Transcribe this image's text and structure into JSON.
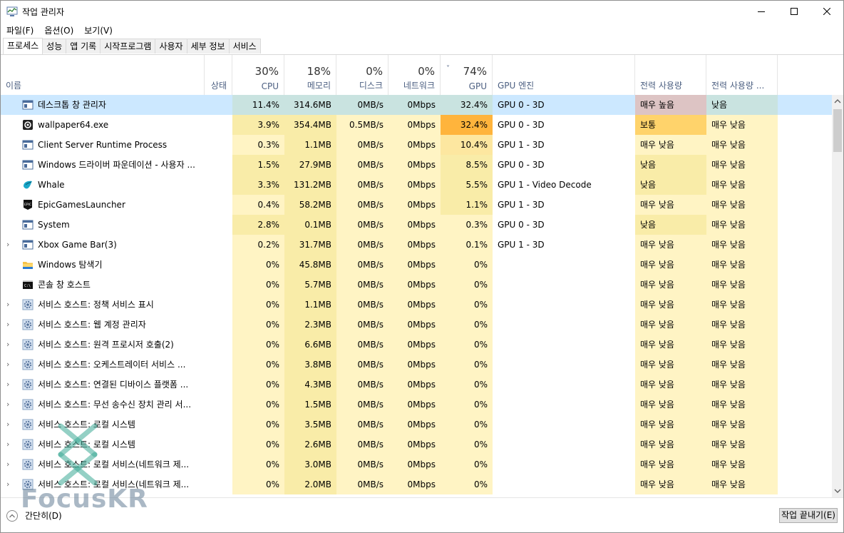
{
  "window": {
    "title": "작업 관리자",
    "app_icon": "task-manager-icon",
    "controls": {
      "minimize": "─",
      "maximize": "☐",
      "close": "✕"
    }
  },
  "menu": [
    "파일(F)",
    "옵션(O)",
    "보기(V)"
  ],
  "tabs": [
    "프로세스",
    "성능",
    "앱 기록",
    "시작프로그램",
    "사용자",
    "세부 정보",
    "서비스"
  ],
  "active_tab": "프로세스",
  "columns": {
    "name": "이름",
    "status": "상태",
    "cpu": {
      "pct": "30%",
      "label": "CPU"
    },
    "mem": {
      "pct": "18%",
      "label": "메모리"
    },
    "disk": {
      "pct": "0%",
      "label": "디스크"
    },
    "net": {
      "pct": "0%",
      "label": "네트워크"
    },
    "gpu": {
      "pct": "74%",
      "label": "GPU",
      "sort": "˅"
    },
    "gpu_engine": "GPU 엔진",
    "power": "전력 사용량",
    "power_trend": "전력 사용량 ..."
  },
  "colors": {
    "heat1": "#fff4c4",
    "heat2": "#f9eca8",
    "heat3": "#fde7a0",
    "heat4": "#ffd36b",
    "heat5": "#ffb43c",
    "selected": "#cce8ff",
    "selected_heat": "#c9e3e0",
    "power_very_high": "#ddc4c4",
    "power_medium": "#ffd36b"
  },
  "processes": [
    {
      "expand": "",
      "icon": "window-app-icon",
      "name": "데스크톱 창 관리자",
      "status": "",
      "cpu": "11.4%",
      "mem": "314.6MB",
      "disk": "0MB/s",
      "net": "0Mbps",
      "gpu": "32.4%",
      "engine": "GPU 0 - 3D",
      "power": "매우 높음",
      "trend": "낮음",
      "selected": true
    },
    {
      "expand": "",
      "icon": "wallpaper-engine-icon",
      "name": "wallpaper64.exe",
      "status": "",
      "cpu": "3.9%",
      "mem": "354.4MB",
      "disk": "0.5MB/s",
      "net": "0Mbps",
      "gpu": "32.4%",
      "engine": "GPU 0 - 3D",
      "power": "보통",
      "trend": "매우 낮음"
    },
    {
      "expand": "",
      "icon": "window-app-icon",
      "name": "Client Server Runtime Process",
      "status": "",
      "cpu": "0.3%",
      "mem": "1.1MB",
      "disk": "0MB/s",
      "net": "0Mbps",
      "gpu": "10.4%",
      "engine": "GPU 1 - 3D",
      "power": "매우 낮음",
      "trend": "매우 낮음"
    },
    {
      "expand": "",
      "icon": "window-app-icon",
      "name": "Windows 드라이버 파운데이션 - 사용자 ...",
      "status": "",
      "cpu": "1.5%",
      "mem": "27.9MB",
      "disk": "0MB/s",
      "net": "0Mbps",
      "gpu": "8.5%",
      "engine": "GPU 0 - 3D",
      "power": "낮음",
      "trend": "매우 낮음"
    },
    {
      "expand": "",
      "icon": "whale-browser-icon",
      "name": "Whale",
      "status": "",
      "cpu": "3.3%",
      "mem": "131.2MB",
      "disk": "0MB/s",
      "net": "0Mbps",
      "gpu": "5.5%",
      "engine": "GPU 1 - Video Decode",
      "power": "낮음",
      "trend": "매우 낮음"
    },
    {
      "expand": "",
      "icon": "epic-games-icon",
      "name": "EpicGamesLauncher",
      "status": "",
      "cpu": "0.4%",
      "mem": "58.2MB",
      "disk": "0MB/s",
      "net": "0Mbps",
      "gpu": "1.1%",
      "engine": "GPU 1 - 3D",
      "power": "매우 낮음",
      "trend": "매우 낮음"
    },
    {
      "expand": "",
      "icon": "window-app-icon",
      "name": "System",
      "status": "",
      "cpu": "2.8%",
      "mem": "0.1MB",
      "disk": "0MB/s",
      "net": "0Mbps",
      "gpu": "0.3%",
      "engine": "GPU 0 - 3D",
      "power": "낮음",
      "trend": "매우 낮음"
    },
    {
      "expand": "›",
      "icon": "window-app-icon",
      "name": "Xbox Game Bar(3)",
      "status": "",
      "cpu": "0.2%",
      "mem": "31.7MB",
      "disk": "0MB/s",
      "net": "0Mbps",
      "gpu": "0.1%",
      "engine": "GPU 1 - 3D",
      "power": "매우 낮음",
      "trend": "매우 낮음"
    },
    {
      "expand": "",
      "icon": "folder-icon",
      "name": "Windows 탐색기",
      "status": "",
      "cpu": "0%",
      "mem": "45.8MB",
      "disk": "0MB/s",
      "net": "0Mbps",
      "gpu": "0%",
      "engine": "",
      "power": "매우 낮음",
      "trend": "매우 낮음"
    },
    {
      "expand": "",
      "icon": "console-icon",
      "name": "콘솔 창 호스트",
      "status": "",
      "cpu": "0%",
      "mem": "5.7MB",
      "disk": "0MB/s",
      "net": "0Mbps",
      "gpu": "0%",
      "engine": "",
      "power": "매우 낮음",
      "trend": "매우 낮음"
    },
    {
      "expand": "›",
      "icon": "service-gear-icon",
      "name": "서비스 호스트: 정책 서비스 표시",
      "status": "",
      "cpu": "0%",
      "mem": "1.1MB",
      "disk": "0MB/s",
      "net": "0Mbps",
      "gpu": "0%",
      "engine": "",
      "power": "매우 낮음",
      "trend": "매우 낮음"
    },
    {
      "expand": "›",
      "icon": "service-gear-icon",
      "name": "서비스 호스트: 웹 계정 관리자",
      "status": "",
      "cpu": "0%",
      "mem": "2.3MB",
      "disk": "0MB/s",
      "net": "0Mbps",
      "gpu": "0%",
      "engine": "",
      "power": "매우 낮음",
      "trend": "매우 낮음"
    },
    {
      "expand": "›",
      "icon": "service-gear-icon",
      "name": "서비스 호스트: 원격 프로시저 호출(2)",
      "status": "",
      "cpu": "0%",
      "mem": "6.6MB",
      "disk": "0MB/s",
      "net": "0Mbps",
      "gpu": "0%",
      "engine": "",
      "power": "매우 낮음",
      "trend": "매우 낮음"
    },
    {
      "expand": "›",
      "icon": "service-gear-icon",
      "name": "서비스 호스트: 오케스트레이터 서비스 ...",
      "status": "",
      "cpu": "0%",
      "mem": "3.8MB",
      "disk": "0MB/s",
      "net": "0Mbps",
      "gpu": "0%",
      "engine": "",
      "power": "매우 낮음",
      "trend": "매우 낮음"
    },
    {
      "expand": "›",
      "icon": "service-gear-icon",
      "name": "서비스 호스트: 연결된 디바이스 플랫폼 ...",
      "status": "",
      "cpu": "0%",
      "mem": "4.3MB",
      "disk": "0MB/s",
      "net": "0Mbps",
      "gpu": "0%",
      "engine": "",
      "power": "매우 낮음",
      "trend": "매우 낮음"
    },
    {
      "expand": "›",
      "icon": "service-gear-icon",
      "name": "서비스 호스트: 무선 송수신 장치 관리 서...",
      "status": "",
      "cpu": "0%",
      "mem": "1.5MB",
      "disk": "0MB/s",
      "net": "0Mbps",
      "gpu": "0%",
      "engine": "",
      "power": "매우 낮음",
      "trend": "매우 낮음"
    },
    {
      "expand": "›",
      "icon": "service-gear-icon",
      "name": "서비스 호스트: 로컬 시스템",
      "status": "",
      "cpu": "0%",
      "mem": "3.5MB",
      "disk": "0MB/s",
      "net": "0Mbps",
      "gpu": "0%",
      "engine": "",
      "power": "매우 낮음",
      "trend": "매우 낮음"
    },
    {
      "expand": "›",
      "icon": "service-gear-icon",
      "name": "서비스 호스트: 로컬 시스템",
      "status": "",
      "cpu": "0%",
      "mem": "2.6MB",
      "disk": "0MB/s",
      "net": "0Mbps",
      "gpu": "0%",
      "engine": "",
      "power": "매우 낮음",
      "trend": "매우 낮음"
    },
    {
      "expand": "›",
      "icon": "service-gear-icon",
      "name": "서비스 호스트: 로컬 서비스(네트워크 제...",
      "status": "",
      "cpu": "0%",
      "mem": "3.0MB",
      "disk": "0MB/s",
      "net": "0Mbps",
      "gpu": "0%",
      "engine": "",
      "power": "매우 낮음",
      "trend": "매우 낮음"
    },
    {
      "expand": "›",
      "icon": "service-gear-icon",
      "name": "서비스 호스트: 로컬 서비스(네트워크 제...",
      "status": "",
      "cpu": "0%",
      "mem": "2.0MB",
      "disk": "0MB/s",
      "net": "0Mbps",
      "gpu": "0%",
      "engine": "",
      "power": "매우 낮음",
      "trend": "매우 낮음"
    }
  ],
  "footer": {
    "collapse_label": "간단히(D)",
    "end_task_label": "작업 끝내기(E)"
  },
  "watermark": "FocusKR"
}
